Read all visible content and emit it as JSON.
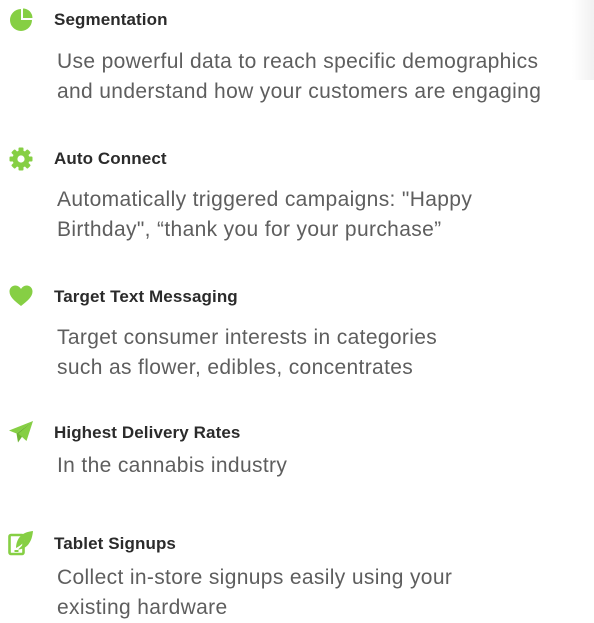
{
  "accent_color": "#86cf44",
  "features": [
    {
      "icon": "pie-chart-icon",
      "title": "Segmentation",
      "lines": [
        "Use powerful data to reach specific demographics",
        "and understand how your customers are engaging"
      ]
    },
    {
      "icon": "gear-icon",
      "title": "Auto Connect",
      "lines": [
        "Automatically triggered campaigns: \"Happy",
        "Birthday\", “thank you for your purchase”"
      ]
    },
    {
      "icon": "heart-icon",
      "title": "Target Text Messaging",
      "lines": [
        "Target consumer interests in categories",
        "such as flower, edibles, concentrates"
      ]
    },
    {
      "icon": "paper-plane-icon",
      "title": "Highest Delivery Rates",
      "lines": [
        "In the cannabis industry"
      ]
    },
    {
      "icon": "tablet-leaf-icon",
      "title": "Tablet Signups",
      "lines": [
        "Collect in-store signups easily using your",
        "existing hardware"
      ]
    }
  ]
}
